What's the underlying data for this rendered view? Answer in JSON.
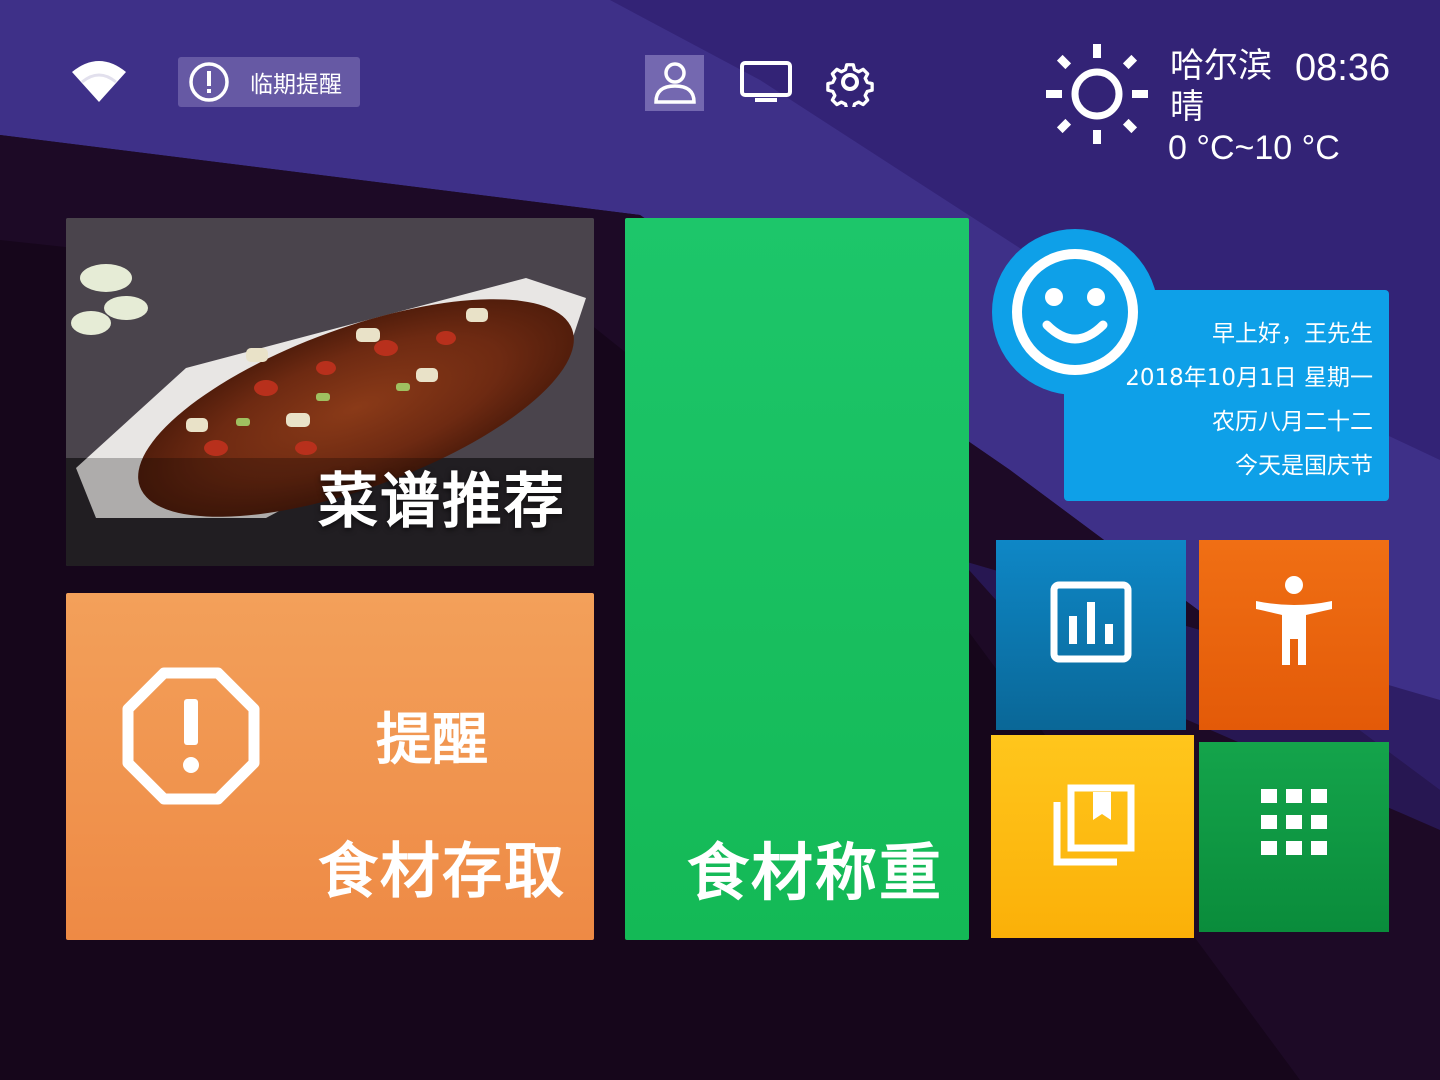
{
  "topbar": {
    "alert_label": "临期提醒"
  },
  "weather": {
    "city": "哈尔滨",
    "time": "08:36",
    "condition": "晴",
    "temp_range": "0 °C~10 °C"
  },
  "tiles": {
    "recipe_label": "菜谱推荐",
    "storage_remind": "提醒",
    "storage_label": "食材存取",
    "weigh_label": "食材称重"
  },
  "greeting": {
    "hello": "早上好，王先生",
    "date": "2018年10月1日 星期一",
    "lunar": "农历八月二十二",
    "holiday": "今天是国庆节"
  },
  "colors": {
    "purple_band": "#3f3189",
    "weigh_green": "#18c060",
    "storage_orange": "#f0904a",
    "card_blue": "#0ea0e8",
    "stats_blue": "#0d7fbd",
    "access_orange": "#ec6510",
    "library_yellow": "#fdbb12",
    "apps_green": "#0f9843"
  }
}
